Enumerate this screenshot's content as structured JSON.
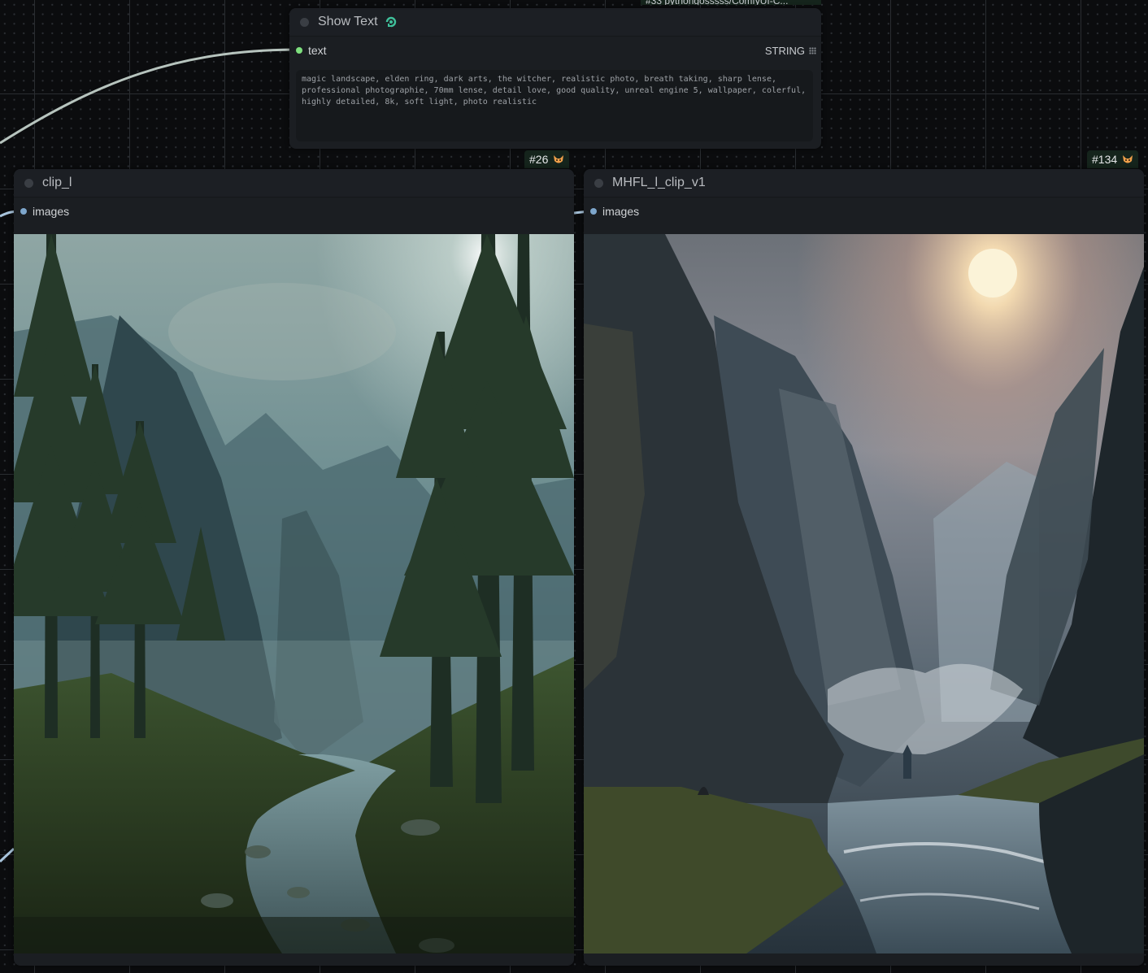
{
  "canvas": {
    "top_badge_text": "#33 pythongosssss/ComfyUI-C..."
  },
  "show_text_node": {
    "title": "Show Text",
    "title_icon": "comfyui-custom-scripts-icon",
    "input_label": "text",
    "output_type": "STRING",
    "text_value": "magic landscape, elden ring, dark arts, the witcher, realistic photo, breath taking, sharp lense,\nprofessional photographie, 70mm lense, detail love, good quality, unreal engine 5, wallpaper, colerful,\nhighly detailed, 8k, soft light, photo realistic"
  },
  "nodes": {
    "clip_l": {
      "title": "clip_l",
      "badge": "#26",
      "input_label": "images",
      "preview": "forest valley with river and tall pine trees under hazy sun"
    },
    "mhfl": {
      "title": "MHFL_l_clip_v1",
      "badge": "#134",
      "input_label": "images",
      "preview": "misty canyon with cliffs, river, and glowing sun"
    }
  },
  "colors": {
    "string_slot": "#7ee07e",
    "image_slot": "#7ea6cc",
    "wire": "#b7c4be",
    "image_wire": "#a8c4dc"
  }
}
